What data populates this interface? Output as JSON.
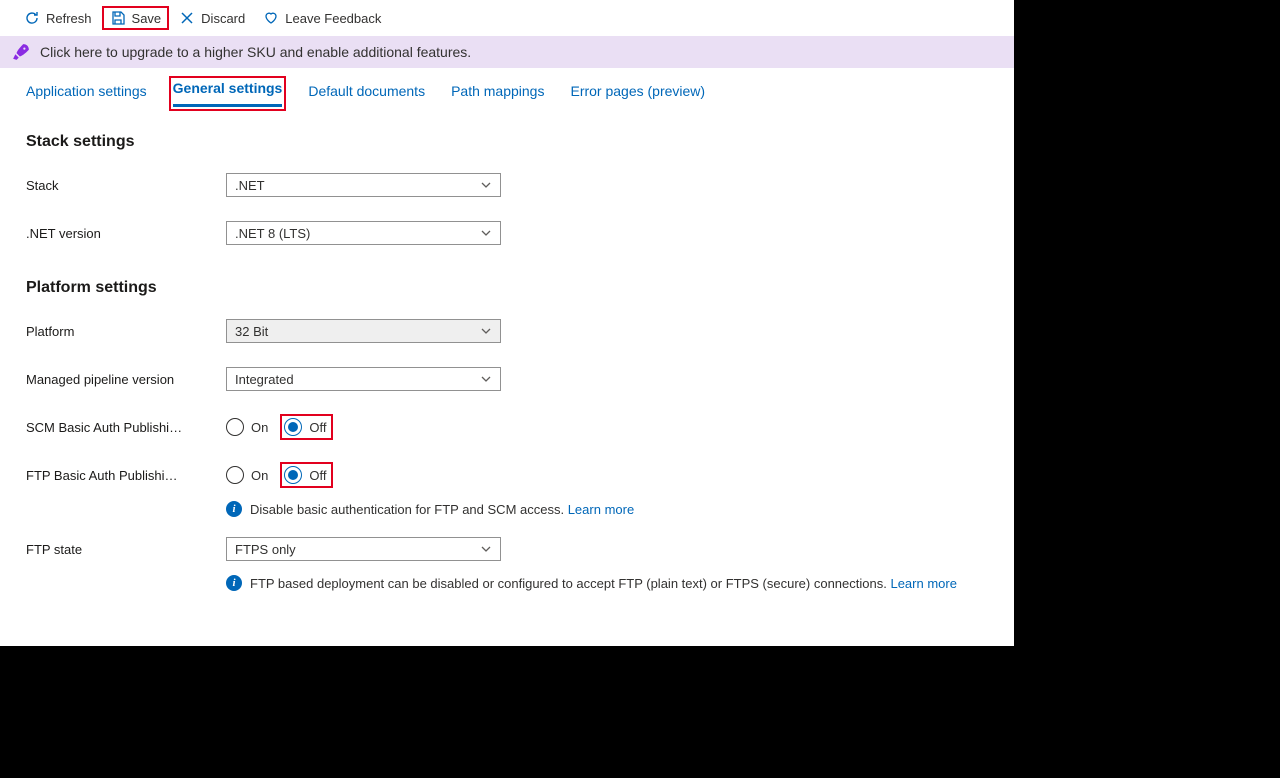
{
  "toolbar": {
    "refresh": "Refresh",
    "save": "Save",
    "discard": "Discard",
    "feedback": "Leave Feedback"
  },
  "upgrade_banner": "Click here to upgrade to a higher SKU and enable additional features.",
  "tabs": {
    "app_settings": "Application settings",
    "general_settings": "General settings",
    "default_docs": "Default documents",
    "path_mappings": "Path mappings",
    "error_pages": "Error pages (preview)"
  },
  "sections": {
    "stack": {
      "title": "Stack settings",
      "stack_label": "Stack",
      "stack_value": ".NET",
      "netver_label": ".NET version",
      "netver_value": ".NET 8 (LTS)"
    },
    "platform": {
      "title": "Platform settings",
      "platform_label": "Platform",
      "platform_value": "32 Bit",
      "mpv_label": "Managed pipeline version",
      "mpv_value": "Integrated",
      "scm_label": "SCM Basic Auth Publishi…",
      "ftp_label": "FTP Basic Auth Publishi…",
      "on": "On",
      "off": "Off",
      "basic_auth_info": "Disable basic authentication for FTP and SCM access.",
      "ftp_state_label": "FTP state",
      "ftp_state_value": "FTPS only",
      "ftp_state_info": "FTP based deployment can be disabled or configured to accept FTP (plain text) or FTPS (secure) connections.",
      "learn_more": "Learn more"
    }
  }
}
